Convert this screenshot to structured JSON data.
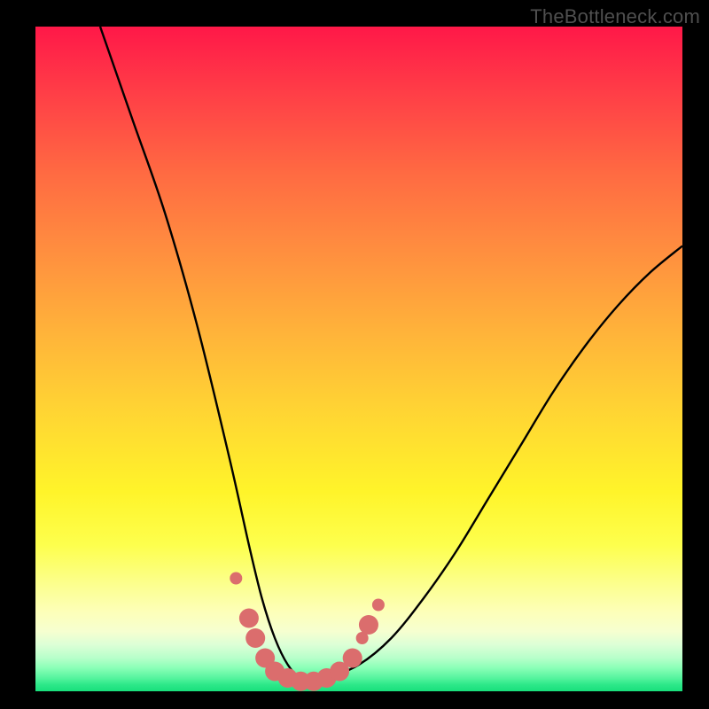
{
  "watermark": "TheBottleneck.com",
  "chart_data": {
    "type": "line",
    "title": "",
    "xlabel": "",
    "ylabel": "",
    "xlim": [
      0,
      100
    ],
    "ylim": [
      0,
      100
    ],
    "grid": false,
    "legend": false,
    "series": [
      {
        "name": "bottleneck-curve",
        "color": "#000000",
        "x": [
          10,
          15,
          20,
          25,
          30,
          33,
          35,
          37,
          39,
          41,
          43,
          45,
          50,
          55,
          60,
          65,
          70,
          75,
          80,
          85,
          90,
          95,
          100
        ],
        "y": [
          100,
          86,
          72,
          55,
          35,
          22,
          14,
          8,
          4,
          2,
          2,
          2,
          4,
          8,
          14,
          21,
          29,
          37,
          45,
          52,
          58,
          63,
          67
        ]
      }
    ],
    "markers": {
      "name": "highlighted-points",
      "color": "#db6d6d",
      "radius_small": 7,
      "radius_large": 11,
      "points": [
        {
          "x": 31.0,
          "y": 17.0,
          "r": "small"
        },
        {
          "x": 33.0,
          "y": 11.0,
          "r": "large"
        },
        {
          "x": 34.0,
          "y": 8.0,
          "r": "large"
        },
        {
          "x": 35.5,
          "y": 5.0,
          "r": "large"
        },
        {
          "x": 37.0,
          "y": 3.0,
          "r": "large"
        },
        {
          "x": 39.0,
          "y": 2.0,
          "r": "large"
        },
        {
          "x": 41.0,
          "y": 1.5,
          "r": "large"
        },
        {
          "x": 43.0,
          "y": 1.5,
          "r": "large"
        },
        {
          "x": 45.0,
          "y": 2.0,
          "r": "large"
        },
        {
          "x": 47.0,
          "y": 3.0,
          "r": "large"
        },
        {
          "x": 49.0,
          "y": 5.0,
          "r": "large"
        },
        {
          "x": 50.5,
          "y": 8.0,
          "r": "small"
        },
        {
          "x": 51.5,
          "y": 10.0,
          "r": "large"
        },
        {
          "x": 53.0,
          "y": 13.0,
          "r": "small"
        }
      ]
    },
    "gradient_stops": [
      {
        "pos": 0,
        "color": "#ff1848"
      },
      {
        "pos": 50,
        "color": "#ffc936"
      },
      {
        "pos": 75,
        "color": "#fff833"
      },
      {
        "pos": 92,
        "color": "#eeffce"
      },
      {
        "pos": 100,
        "color": "#18df7c"
      }
    ]
  }
}
